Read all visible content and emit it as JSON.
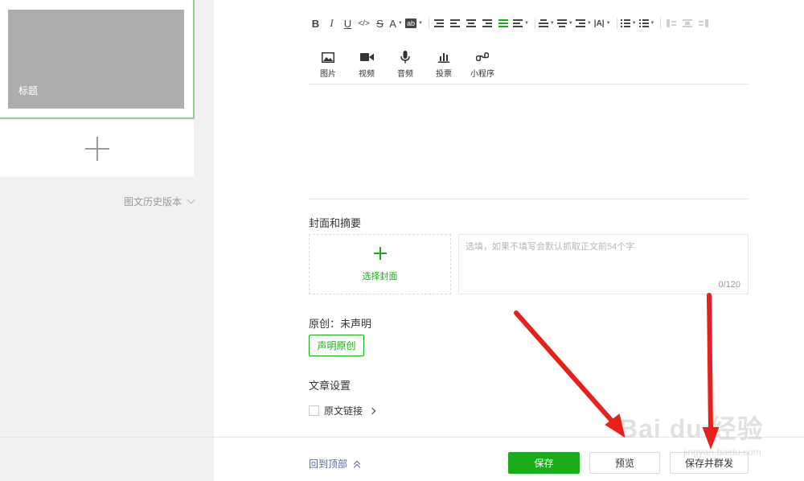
{
  "sidebar": {
    "article_title": "标题",
    "history_label": "图文历史版本"
  },
  "toolbar": {
    "bold": "B",
    "italic": "I",
    "underline": "U",
    "code": "</>",
    "strike": "S",
    "font_color": "A",
    "highlight": "ab"
  },
  "media_bar": {
    "items": [
      {
        "label": "图片",
        "icon": "image-icon"
      },
      {
        "label": "视频",
        "icon": "video-icon"
      },
      {
        "label": "音频",
        "icon": "microphone-icon"
      },
      {
        "label": "投票",
        "icon": "vote-chart-icon"
      },
      {
        "label": "小程序",
        "icon": "mini-program-icon"
      }
    ]
  },
  "cover_section": {
    "title": "封面和摘要",
    "select_cover_label": "选择封面",
    "summary_placeholder": "选填，如果不填写会默认抓取正文前54个字",
    "summary_value": "",
    "summary_counter": "0/120"
  },
  "original_section": {
    "label": "原创：未声明",
    "declare_button": "声明原创"
  },
  "article_settings": {
    "title": "文章设置",
    "original_link_label": "原文链接"
  },
  "footer": {
    "back_to_top": "回到顶部",
    "save_button": "保存",
    "preview_button": "预览",
    "save_and_mass_send_button": "保存并群发"
  },
  "watermark": {
    "text": "Bai du 经验",
    "sub": "jingyan.baidu.com"
  },
  "colors": {
    "accent": "#1aad19",
    "link": "#576b95",
    "arrow": "#e8201b",
    "sidebar_bg": "#f1f1f1"
  }
}
